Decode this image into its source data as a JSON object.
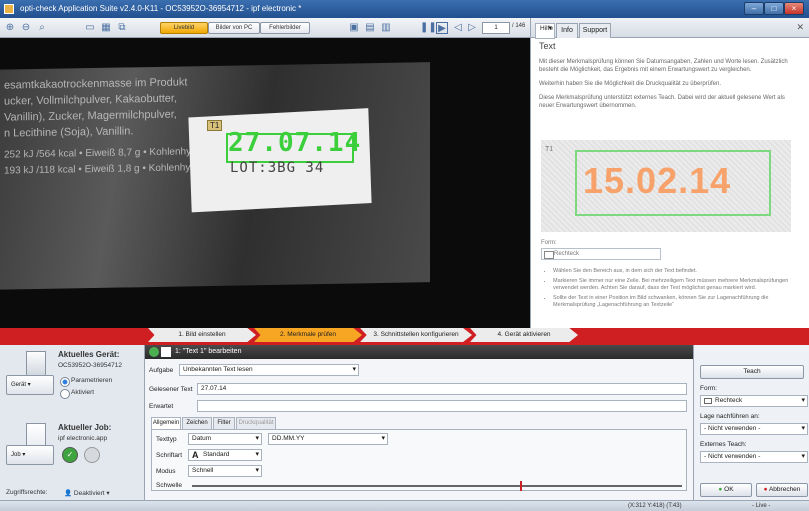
{
  "window": {
    "title": "opti-check Application Suite v2.4.0-K11 - OC53952O-36954712 - ipf electronic *"
  },
  "toolbar": {
    "live_label": "Livebild",
    "pc_images_label": "Bilder von PC",
    "error_images_label": "Fehlerbilder",
    "page_current": "1",
    "page_total": "/ 146"
  },
  "camera": {
    "product_lines": [
      "esamtkakaotrockenmasse im Produkt",
      "ucker, Vollmilchpulver, Kakaobutter,",
      "Vanillin), Zucker, Magermilchpulver,",
      "n Lecithine (Soja), Vanillin.",
      "252 kJ /564 kcal • Eiweiß 8,7 g • Kohlenhydrate 53,5 g • Fett 34,8 g;",
      "193 kJ /118 kcal • Eiweiß 1,8 g • Kohlenhydrate 11,2 g • Fett 7,3 g"
    ],
    "roi_tag": "T1",
    "detected_date": "27.07.14",
    "lot_text": "LOT:3BG 34"
  },
  "help": {
    "tabs": [
      "Hilfe",
      "Info",
      "Support"
    ],
    "heading": "Text",
    "para1": "Mit dieser Merkmalsprüfung können Sie Datumsangaben, Zahlen und Worte lesen. Zusätzlich besteht die Möglichkeit, das Ergebnis mit einem Erwartungswert zu vergleichen.",
    "para2": "Weiterhin haben Sie die Möglichkeit die Druckqualität zu überprüfen.",
    "para3": "Diese Merkmalsprüfung unterstützt externes Teach. Dabei wird der aktuell gelesene Wert als neuer Erwartungswert übernommen.",
    "image_tag": "T1",
    "image_date": "15.02.14",
    "form_label": "Form:",
    "form_value": "Rechteck",
    "bullets": [
      "Wählen Sie den Bereich aus, in dem sich der Text befindet.",
      "Markieren Sie immer nur eine Zeile. Bei mehrzeiligem Text müssen mehrere Merkmalsprüfungen verwendet werden. Achten Sie darauf, dass der Text möglichst genau markiert wird.",
      "Sollte der Text in einer Position im Bild schwanken, können Sie zur Lagenachführung die Merkmalsprüfung „Lagenachführung an Textzeile“"
    ]
  },
  "steps": [
    "1. Bild einstellen",
    "2. Merkmale prüfen",
    "3. Schnittstellen konfigurieren",
    "4. Gerät aktivieren"
  ],
  "device": {
    "title": "Aktuelles Gerät:",
    "id": "OC53952O-36954712",
    "button_label": "Gerät",
    "radio_param": "Parametrieren",
    "radio_active": "Aktiviert"
  },
  "job": {
    "title": "Aktueller Job:",
    "name": "ipf electronic.app",
    "button_label": "Job"
  },
  "access": {
    "label": "Zugriffsrechte:",
    "value": "Deaktiviert"
  },
  "editor": {
    "header": "1: \"Text 1\" bearbeiten",
    "task_label": "Aufgabe",
    "task_value": "Unbekannten Text lesen",
    "read_label": "Gelesener Text",
    "read_value": "27.07.14",
    "expected_label": "Erwartet",
    "tabs": [
      "Allgemein",
      "Zeichen",
      "Filter",
      "Druckqualität"
    ],
    "texttype_label": "Texttyp",
    "texttype_value": "Datum",
    "format_value": "DD.MM.YY",
    "font_label": "Schriftart",
    "font_value": "Standard",
    "mode_label": "Modus",
    "mode_value": "Schnell",
    "threshold_label": "Schwelle",
    "threshold_fraction": 0.67
  },
  "right": {
    "teach_label": "Teach",
    "form_label": "Form:",
    "form_value": "Rechteck",
    "track_label": "Lage nachführen an:",
    "track_value": "- Nicht verwenden -",
    "ext_label": "Externes Teach:",
    "ext_value": "- Nicht verwenden -",
    "ok_label": "OK",
    "cancel_label": "Abbrechen"
  },
  "status": {
    "coords": "(X:312 Y:418) (T:43)",
    "mode": "- Live -"
  },
  "colors": {
    "accent": "#cf1f23",
    "active_step": "#f6a623",
    "detect_green": "#3ccf3c"
  }
}
